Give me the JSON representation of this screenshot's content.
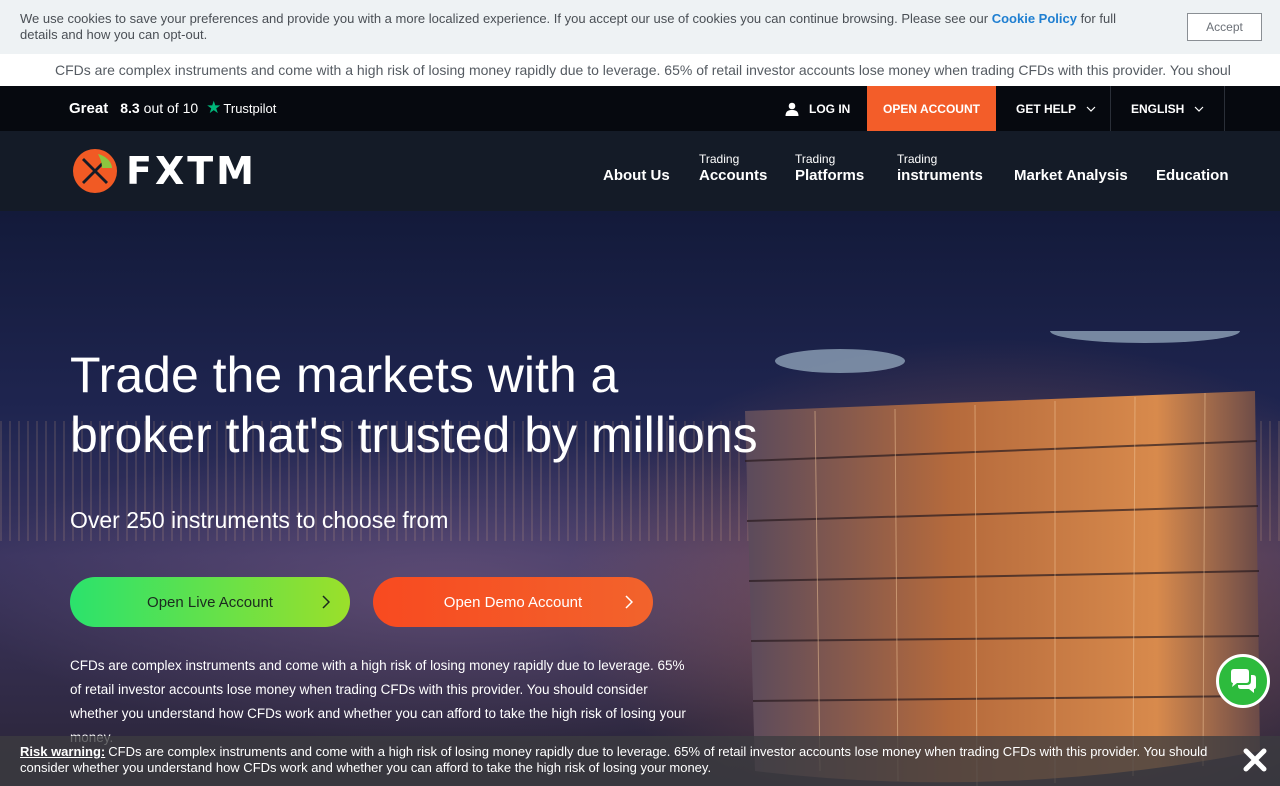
{
  "cookie": {
    "text_before": "We use cookies to save your preferences and provide you with a more localized experience. If you accept our use of cookies you can continue browsing. Please see our ",
    "link": "Cookie Policy",
    "text_after": " for full details and how you can opt-out.",
    "accept_label": "Accept"
  },
  "ticker": {
    "text": "CFDs are complex instruments and come with a high risk of losing money rapidly due to leverage. 65% of retail investor accounts lose money when trading CFDs with this provider. You shoul"
  },
  "topbar": {
    "trust_rating": "Great",
    "trust_score": "8.3",
    "trust_outof": "out of 10",
    "trust_brand": "Trustpilot",
    "login": "LOG IN",
    "open_account": "OPEN ACCOUNT",
    "get_help": "GET HELP",
    "language": "ENGLISH"
  },
  "nav": {
    "logo": "FXTM",
    "about": "About Us",
    "accounts_small": "Trading",
    "accounts_big": "Accounts",
    "platforms_small": "Trading",
    "platforms_big": "Platforms",
    "instruments_small": "Trading",
    "instruments_big": "instruments",
    "market_analysis": "Market Analysis",
    "education": "Education"
  },
  "hero": {
    "title": "Trade the markets with a broker that's trusted by millions",
    "subtitle": "Over 250 instruments to choose from",
    "live_button": "Open Live Account",
    "demo_button": "Open Demo Account",
    "risk_text": "CFDs are complex instruments and come with a high risk of losing money rapidly due to leverage. 65% of retail investor accounts lose money when trading CFDs with this provider. You should consider whether you understand how CFDs work and whether you can afford to take the high risk of losing your money."
  },
  "risk_warning": {
    "label": "Risk warning:",
    "text": "CFDs are complex instruments and come with a high risk of losing money rapidly due to leverage. 65% of retail investor accounts lose money when trading CFDs with this provider. You should consider whether you understand how CFDs work and whether you can afford to take the high risk of losing your money."
  },
  "icons": {
    "user": "user-icon",
    "star": "star-icon",
    "chevron": "chevron-down-icon",
    "chat": "chat-icon",
    "close": "close-icon"
  },
  "colors": {
    "accent_orange": "#f35d29",
    "live_green": "#2be26c",
    "trustpilot_green": "#00b67a"
  }
}
